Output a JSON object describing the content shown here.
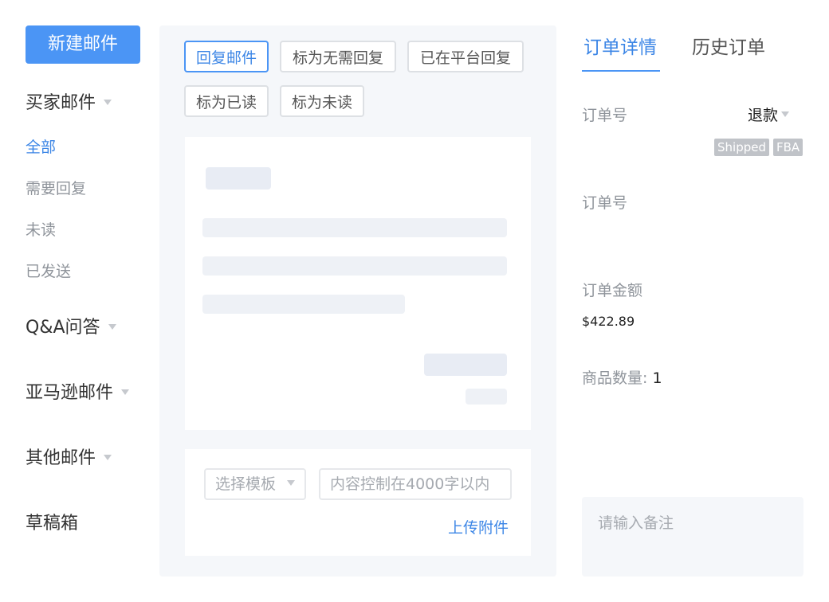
{
  "sidebar": {
    "new_mail_label": "新建邮件",
    "groups": {
      "buyer": "买家邮件",
      "qa": "Q&A问答",
      "amazon": "亚马逊邮件",
      "other": "其他邮件",
      "drafts": "草稿箱"
    },
    "buyer_items": [
      "全部",
      "需要回复",
      "未读",
      "已发送"
    ]
  },
  "actions": {
    "reply": "回复邮件",
    "no_reply": "标为无需回复",
    "replied_platform": "已在平台回复",
    "mark_read": "标为已读",
    "mark_unread": "标为未读"
  },
  "compose": {
    "template_placeholder": "选择模板",
    "content_placeholder": "内容控制在4000字以内",
    "upload_label": "上传附件"
  },
  "right": {
    "tabs": [
      "订单详情",
      "历史订单"
    ],
    "order_no_label": "订单号",
    "refund_label": "退款",
    "tags": [
      "Shipped",
      "FBA"
    ],
    "order_no_label_2": "订单号",
    "amount_label": "订单金额",
    "amount_value": "$422.89",
    "qty_label": "商品数量:",
    "qty_value": "1",
    "remark_placeholder": "请输入备注"
  },
  "colors": {
    "accent": "#4b95f5",
    "link": "#3c86e6",
    "muted": "#8f949b",
    "panel_bg": "#f5f7fa"
  }
}
